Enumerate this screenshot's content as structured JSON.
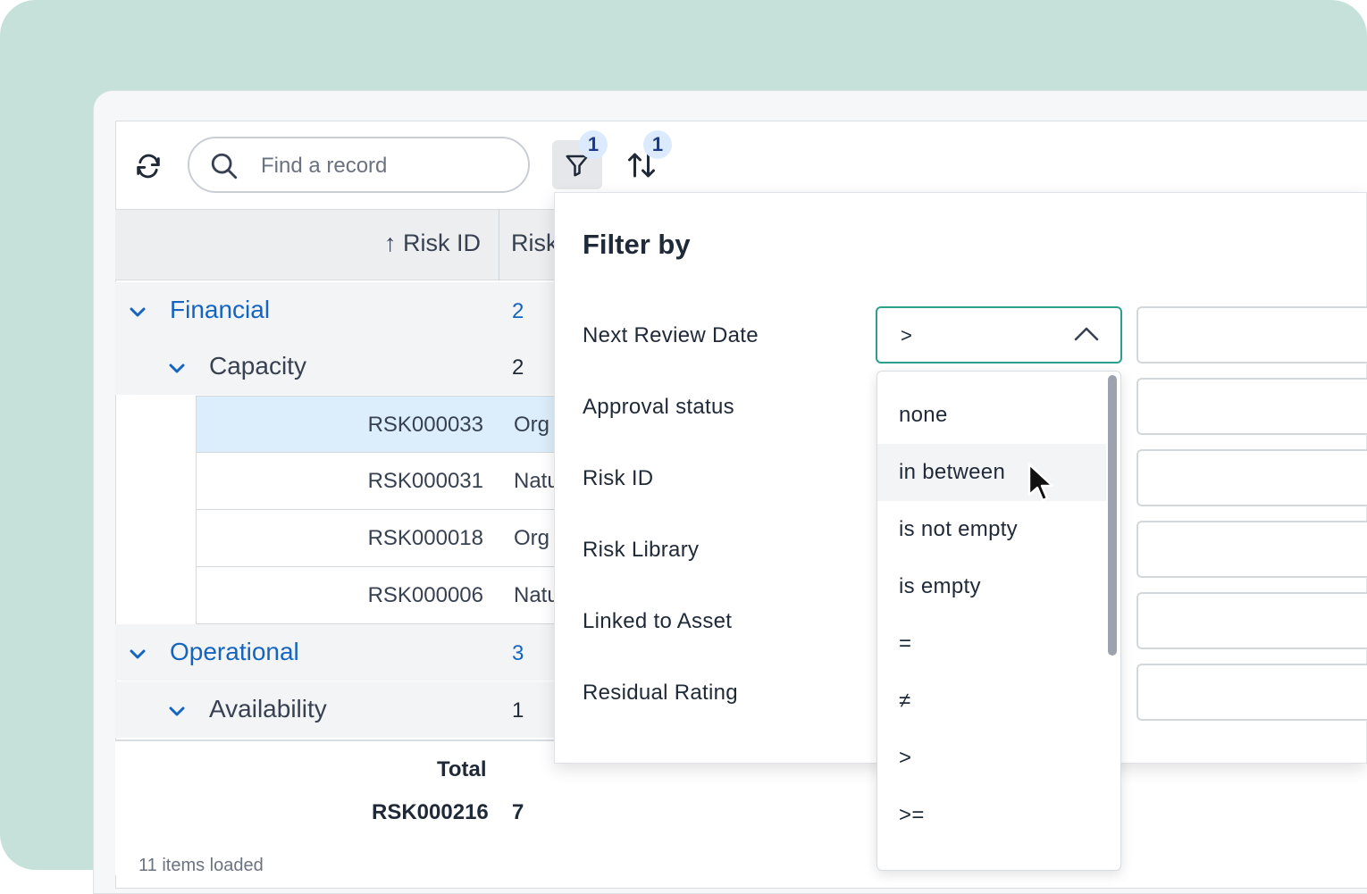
{
  "toolbar": {
    "search_placeholder": "Find a record",
    "filter_badge": "1",
    "sort_badge": "1"
  },
  "grid": {
    "columns": [
      "↑ Risk ID",
      "Risk"
    ],
    "groups": [
      {
        "label": "Financial",
        "count": "2"
      },
      {
        "label": "Capacity",
        "count": "2"
      },
      {
        "label": "Operational",
        "count": "3"
      },
      {
        "label": "Availability",
        "count": "1"
      }
    ],
    "rows": [
      {
        "id": "RSK000033",
        "col2": "Org"
      },
      {
        "id": "RSK000031",
        "col2": "Natu"
      },
      {
        "id": "RSK000018",
        "col2": "Org"
      },
      {
        "id": "RSK000006",
        "col2": "Natu"
      }
    ],
    "footer": {
      "total_label": "Total",
      "total_id": "RSK000216",
      "total_count": "7",
      "note": "11 items loaded"
    }
  },
  "filter": {
    "title": "Filter by",
    "fields": [
      "Next Review Date",
      "Approval status",
      "Risk ID",
      "Risk Library",
      "Linked to Asset",
      "Residual Rating"
    ],
    "operator_value": ">",
    "operator_options": [
      "none",
      "in between",
      "is not empty",
      "is empty",
      "=",
      "≠",
      ">",
      ">="
    ]
  },
  "colors": {
    "accent": "#1565c0",
    "focus_border": "#2e9e8e",
    "selected_row": "#dceefb",
    "backdrop": "#c5e1da"
  }
}
